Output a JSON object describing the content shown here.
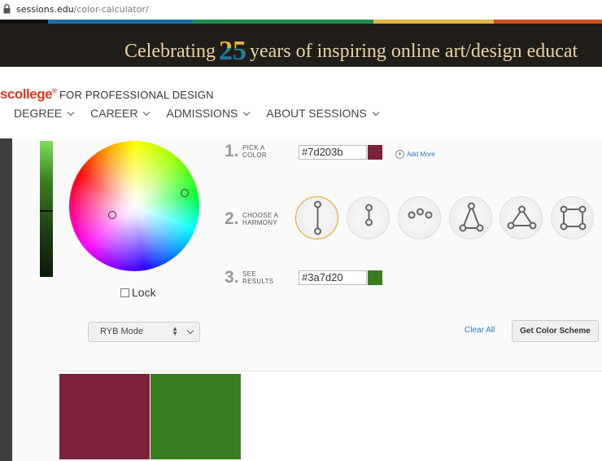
{
  "browser": {
    "url_host": "sessions.edu",
    "url_path": "/color-calculator/"
  },
  "banner": {
    "before": "Celebrating",
    "number": "25",
    "after": "years of inspiring online art/design educat"
  },
  "header": {
    "logo": "scollege",
    "logo_mark": "®",
    "tagline": "FOR PROFESSIONAL DESIGN",
    "nav": [
      {
        "label": "DEGREE"
      },
      {
        "label": "CAREER"
      },
      {
        "label": "ADMISSIONS"
      },
      {
        "label": "ABOUT SESSIONS"
      }
    ]
  },
  "calculator": {
    "lock_label": "Lock",
    "steps": [
      {
        "num": "1.",
        "label_line1": "PICK A",
        "label_line2": "COLOR"
      },
      {
        "num": "2.",
        "label_line1": "CHOOSE A",
        "label_line2": "HARMONY"
      },
      {
        "num": "3.",
        "label_line1": "SEE",
        "label_line2": "RESULTS"
      }
    ],
    "pick_color_value": "#7d203b",
    "result_color_value": "#3a7d20",
    "add_more": "Add More",
    "mode_select": "RYB Mode",
    "clear_all": "Clear All",
    "get_scheme": "Get Color Scheme",
    "harmonies": [
      "complementary",
      "split-complementary",
      "analogous",
      "triad",
      "triangle",
      "square"
    ],
    "results": [
      "#7d203b",
      "#3a7d20"
    ]
  },
  "colors": {
    "accent": "#2f7bbf",
    "logo": "#d83a1f",
    "banner_bg": "#211d18",
    "selected_ring": "#e8a020"
  }
}
